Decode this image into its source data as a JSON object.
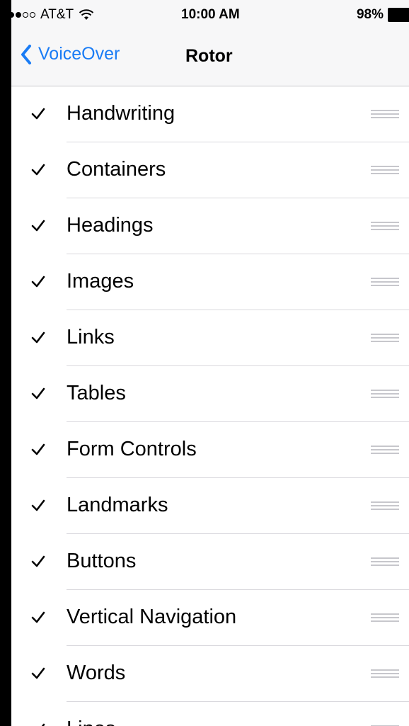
{
  "status_bar": {
    "carrier": "AT&T",
    "time": "10:00 AM",
    "battery": "98%",
    "signal_bars_filled": 3,
    "signal_bars_total": 5,
    "battery_level": 0.98
  },
  "nav": {
    "back_label": "VoiceOver",
    "title": "Rotor"
  },
  "rotor_items": [
    {
      "label": "Handwriting",
      "checked": true
    },
    {
      "label": "Containers",
      "checked": true
    },
    {
      "label": "Headings",
      "checked": true
    },
    {
      "label": "Images",
      "checked": true
    },
    {
      "label": "Links",
      "checked": true
    },
    {
      "label": "Tables",
      "checked": true
    },
    {
      "label": "Form Controls",
      "checked": true
    },
    {
      "label": "Landmarks",
      "checked": true
    },
    {
      "label": "Buttons",
      "checked": true
    },
    {
      "label": "Vertical Navigation",
      "checked": true
    },
    {
      "label": "Words",
      "checked": true
    },
    {
      "label": "Lines",
      "checked": true
    }
  ],
  "colors": {
    "accent": "#1a7cf5",
    "bar_background": "#f7f7f8",
    "separator": "#d9d8dd",
    "grip": "#c7c7cc"
  },
  "icons": {
    "back": "chevron-left-icon",
    "check": "checkmark-icon",
    "reorder": "reorder-grip-icon",
    "wifi": "wifi-icon",
    "battery": "battery-icon"
  }
}
